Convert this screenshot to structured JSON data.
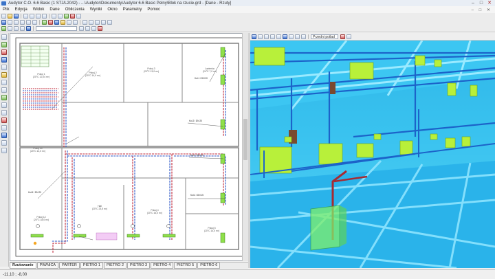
{
  "window": {
    "title": "Audytor C.O. 6.6 Basic (1 STJ/L2042) - ...\\Audytor\\Dokumenty\\Audytor 6.6 Basic Pelny\\Blok na rzucie.grd - [Dane - Rzuty]",
    "min": "–",
    "max": "□",
    "close": "✕"
  },
  "menu": {
    "items": [
      "Plik",
      "Edycja",
      "Widok",
      "Dane",
      "Obliczenia",
      "Wyniki",
      "Okno",
      "Parametry",
      "Pomoc"
    ],
    "mdi_controls": "– □ ✕"
  },
  "view3d": {
    "view_select": "Przedni potlad"
  },
  "plan": {
    "rooms": [
      {
        "label": "Pokoj 1",
        "area": "(20°C 12,04 m²)"
      },
      {
        "label": "Pokoj 2",
        "area": "(20°C 14,0 m²)"
      },
      {
        "label": "Pokoj 3",
        "area": "(20°C 13,0 m²)"
      },
      {
        "label": "Lazienka",
        "area": "(24°C 7,0 m²)"
      },
      {
        "label": "Pokoj 10",
        "area": "(20°C 12,0 m²)"
      },
      {
        "label": "Pokoj 12",
        "area": "(20°C 18,0 m²)"
      },
      {
        "label": "Hall",
        "area": "(20°C 23,5 m²)"
      },
      {
        "label": "Pokoj 4",
        "area": "(20°C 16,0 m²)"
      },
      {
        "label": "Pokoj 5",
        "area": "(20°C 14,0 m²)"
      }
    ],
    "pipe_labels": [
      "Kol.1 / DN 20",
      "Kol.2 / DN 20",
      "Kol.3 / DN 20",
      "Kol.4 / DN 15",
      "Kol.5 / DN 15",
      "Kol.6 / DN 20"
    ]
  },
  "sheet_tabs": [
    "Rzutowanie",
    "PIWNICA",
    "PARTER",
    "PIETRO 1",
    "PIETRO 2",
    "PIETRO 3",
    "PIETRO 4",
    "PIETRO 5",
    "PIETRO 6"
  ],
  "status": {
    "coordinates": "-11,10 ; -8,00"
  },
  "colors": {
    "sky": "#39c2ef",
    "radiator": "#b8f03a",
    "pipe": "#1c63c9",
    "supply_pipe": "#c0283a"
  }
}
